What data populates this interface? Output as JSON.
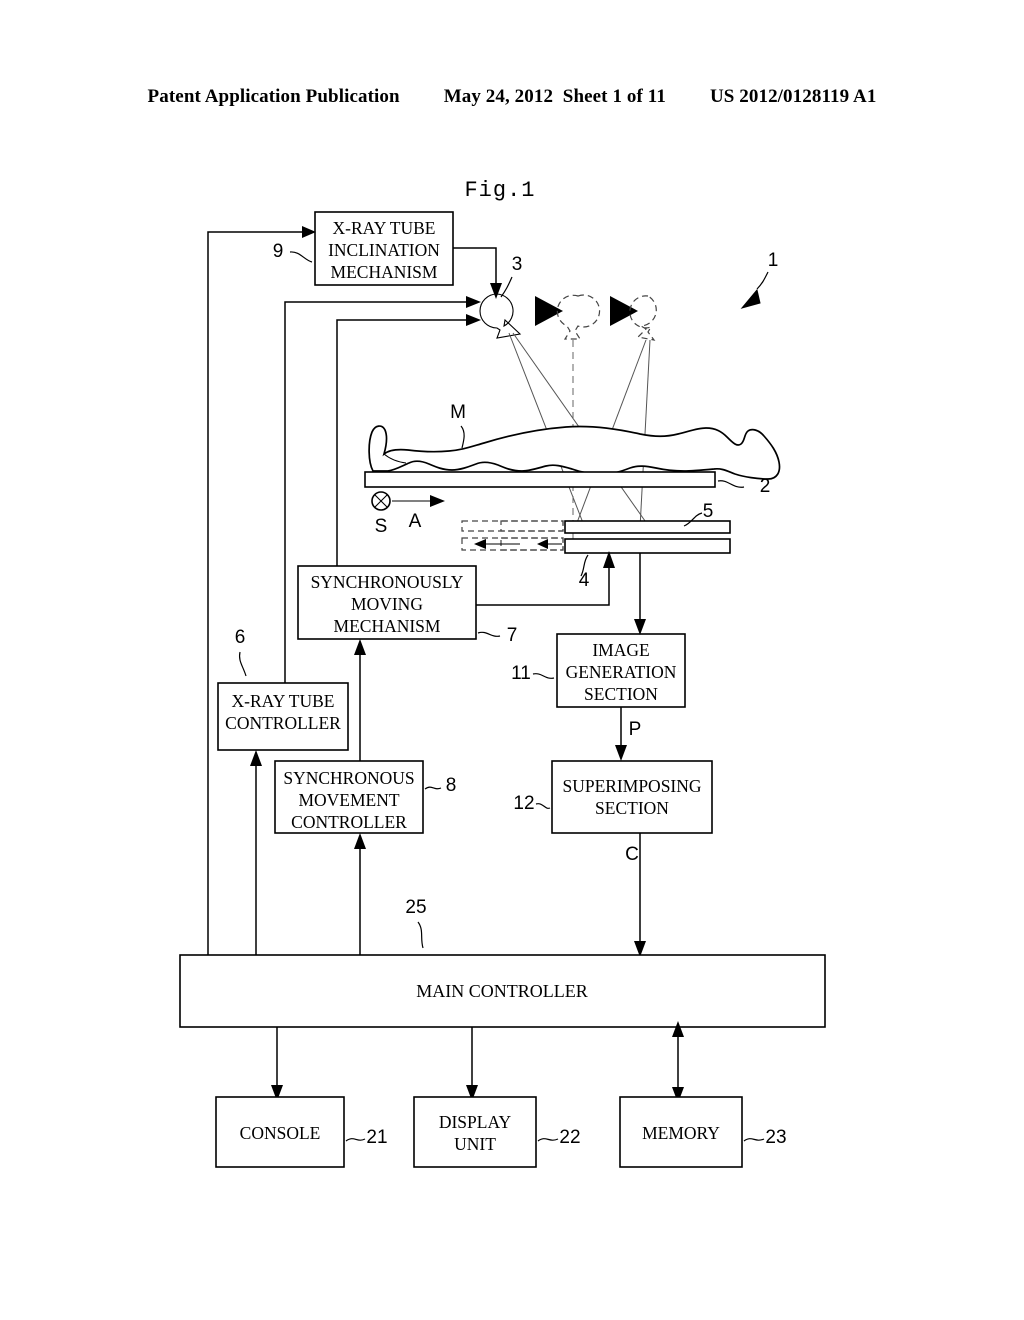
{
  "header": {
    "publication": "Patent Application Publication",
    "date": "May 24, 2012",
    "sheet": "Sheet 1 of 11",
    "number": "US 2012/0128119 A1"
  },
  "figure": {
    "title": "Fig.1",
    "boxes": [
      {
        "id": "xray-tube-inclination-mechanism",
        "lines": [
          "X-RAY TUBE",
          "INCLINATION",
          "MECHANISM"
        ],
        "ref": "9"
      },
      {
        "id": "synchronously-moving-mechanism",
        "lines": [
          "SYNCHRONOUSLY",
          "MOVING",
          "MECHANISM"
        ],
        "ref": "7"
      },
      {
        "id": "xray-tube-controller",
        "lines": [
          "X-RAY TUBE",
          "CONTROLLER"
        ],
        "ref": "6"
      },
      {
        "id": "synchronous-movement-controller",
        "lines": [
          "SYNCHRONOUS",
          "MOVEMENT",
          "CONTROLLER"
        ],
        "ref": "8"
      },
      {
        "id": "image-generation-section",
        "lines": [
          "IMAGE",
          "GENERATION",
          "SECTION"
        ],
        "ref": "11"
      },
      {
        "id": "superimposing-section",
        "lines": [
          "SUPERIMPOSING",
          "SECTION"
        ],
        "ref": "12"
      },
      {
        "id": "main-controller",
        "lines": [
          "MAIN CONTROLLER"
        ],
        "ref": "25"
      },
      {
        "id": "console",
        "lines": [
          "CONSOLE"
        ],
        "ref": "21"
      },
      {
        "id": "display-unit",
        "lines": [
          "DISPLAY",
          "UNIT"
        ],
        "ref": "22"
      },
      {
        "id": "memory",
        "lines": [
          "MEMORY"
        ],
        "ref": "23"
      }
    ],
    "reference_numerals": {
      "system": "1",
      "table": "2",
      "xray_tube": "3",
      "detector": "4",
      "grid": "5",
      "xray_tube_controller": "6",
      "synchronously_moving_mechanism": "7",
      "synchronous_movement_controller": "8",
      "xray_tube_inclination_mechanism": "9",
      "image_generation_section": "11",
      "superimposing_section": "12",
      "console": "21",
      "display_unit": "22",
      "memory": "23",
      "main_controller": "25"
    },
    "signal_labels": {
      "subject": "M",
      "body_axis": "A",
      "scan_direction": "S",
      "projection_image": "P",
      "composite_image": "C"
    }
  }
}
